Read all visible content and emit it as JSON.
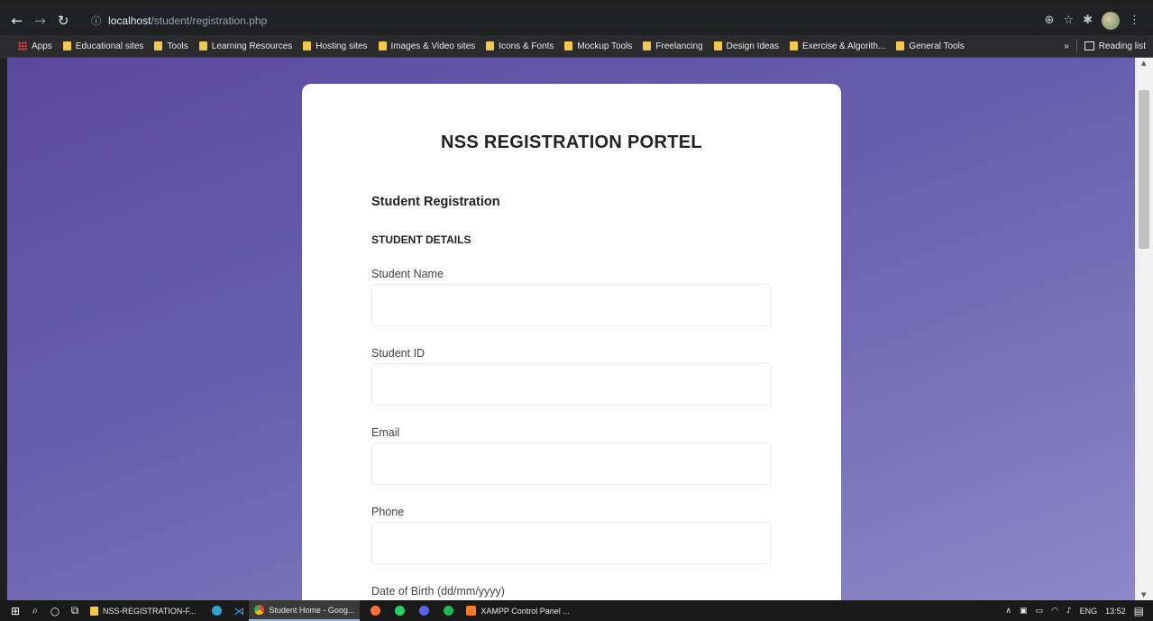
{
  "browser": {
    "url_host": "localhost",
    "url_path": "/student/registration.php",
    "bookmarks": [
      "Educational sites",
      "Tools",
      "Learning Resources",
      "Hosting sites",
      "Images & Video sites",
      "Icons & Fonts",
      "Mockup Tools",
      "Freelancing",
      "Design Ideas",
      "Exercise & Algorith...",
      "General Tools"
    ],
    "apps_label": "Apps",
    "more_label": "»",
    "reading_list_label": "Reading list"
  },
  "form": {
    "portal_title": "NSS REGISTRATION PORTEL",
    "section_title": "Student Registration",
    "subsection_title": "STUDENT DETAILS",
    "fields": [
      {
        "label": "Student Name",
        "value": ""
      },
      {
        "label": "Student ID",
        "value": ""
      },
      {
        "label": "Email",
        "value": ""
      },
      {
        "label": "Phone",
        "value": ""
      },
      {
        "label": "Date of Birth (dd/mm/yyyy)",
        "value": ""
      }
    ]
  },
  "taskbar": {
    "apps": [
      {
        "label": "NSS-REGISTRATION-F..."
      },
      {
        "label": "Student Home - Goog..."
      },
      {
        "label": "XAMPP Control Panel ..."
      }
    ],
    "language": "ENG",
    "time": "13:52"
  }
}
